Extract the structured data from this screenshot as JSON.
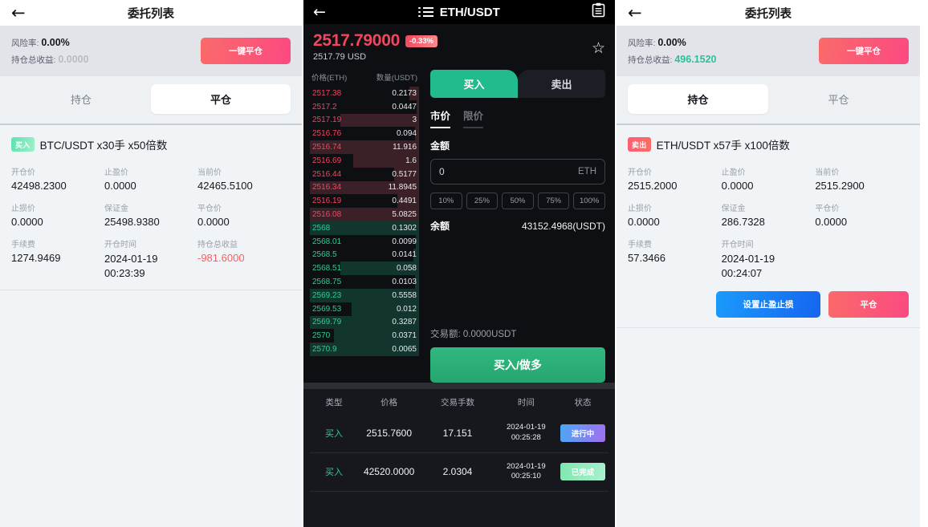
{
  "panel_left": {
    "header": {
      "back_icon": "back-arrow-icon",
      "title": "委托列表"
    },
    "risk": {
      "risk_label": "风险率:",
      "risk_value": "0.00%",
      "profit_label": "持仓总收益:",
      "profit_value": "0.0000",
      "close_all_label": "一键平仓"
    },
    "tabs": [
      {
        "label": "持仓",
        "active": false
      },
      {
        "label": "平仓",
        "active": true
      }
    ],
    "card": {
      "side_tag": "买入",
      "side_type": "buy",
      "title": "BTC/USDT x30手 x50倍数",
      "fields": [
        {
          "label": "开仓价",
          "value": "42498.2300",
          "tone": "normal"
        },
        {
          "label": "止盈价",
          "value": "0.0000",
          "tone": "normal"
        },
        {
          "label": "当前价",
          "value": "42465.5100",
          "tone": "normal"
        },
        {
          "label": "止损价",
          "value": "0.0000",
          "tone": "normal"
        },
        {
          "label": "保证金",
          "value": "25498.9380",
          "tone": "normal"
        },
        {
          "label": "平仓价",
          "value": "0.0000",
          "tone": "normal"
        },
        {
          "label": "手续费",
          "value": "1274.9469",
          "tone": "normal"
        },
        {
          "label": "开仓时间",
          "value": "2024-01-19 00:23:39",
          "tone": "time"
        },
        {
          "label": "持仓总收益",
          "value": "-981.6000",
          "tone": "negative"
        }
      ]
    }
  },
  "panel_middle": {
    "header": {
      "back_icon": "back-arrow-icon",
      "list_icon": "list-icon",
      "title": "ETH/USDT",
      "clipboard_icon": "clipboard-icon"
    },
    "ticker": {
      "price": "2517.79000",
      "change_pct": "-0.33%",
      "usd": "2517.79 USD",
      "star_icon": "star-icon"
    },
    "orderbook": {
      "col_price": "价格(ETH)",
      "col_amount": "数量(USDT)",
      "asks": [
        {
          "price": "2517.38",
          "amount": "0.2173",
          "depth": 9
        },
        {
          "price": "2517.2",
          "amount": "0.0447",
          "depth": 2
        },
        {
          "price": "2517.19",
          "amount": "3",
          "depth": 72
        },
        {
          "price": "2516.76",
          "amount": "0.094",
          "depth": 4
        },
        {
          "price": "2516.74",
          "amount": "11.916",
          "depth": 100
        },
        {
          "price": "2516.69",
          "amount": "1.6",
          "depth": 60
        },
        {
          "price": "2516.44",
          "amount": "0.5177",
          "depth": 23
        },
        {
          "price": "2516.34",
          "amount": "11.8945",
          "depth": 100
        },
        {
          "price": "2516.19",
          "amount": "0.4491",
          "depth": 20
        },
        {
          "price": "2516.08",
          "amount": "5.0825",
          "depth": 100
        }
      ],
      "bids": [
        {
          "price": "2568",
          "amount": "0.1302",
          "depth": 100
        },
        {
          "price": "2568.01",
          "amount": "0.0099",
          "depth": 3
        },
        {
          "price": "2568.5",
          "amount": "0.0141",
          "depth": 5
        },
        {
          "price": "2568.51",
          "amount": "0.058",
          "depth": 72
        },
        {
          "price": "2568.75",
          "amount": "0.0103",
          "depth": 4
        },
        {
          "price": "2569.23",
          "amount": "0.5558",
          "depth": 100
        },
        {
          "price": "2569.53",
          "amount": "0.012",
          "depth": 62
        },
        {
          "price": "2569.79",
          "amount": "0.3287",
          "depth": 100
        },
        {
          "price": "2570",
          "amount": "0.0371",
          "depth": 78
        },
        {
          "price": "2570.9",
          "amount": "0.0065",
          "depth": 100
        }
      ]
    },
    "form": {
      "buy_tab": "买入",
      "sell_tab": "卖出",
      "market_tab": "市价",
      "limit_tab": "限价",
      "amount_label": "金额",
      "amount_value": "0",
      "amount_unit": "ETH",
      "percents": [
        "10%",
        "25%",
        "50%",
        "75%",
        "100%"
      ],
      "balance_label": "余额",
      "balance_value": "43152.4968(USDT)",
      "turnover_label": "交易额:",
      "turnover_value": "0.0000USDT",
      "submit_label": "买入/做多"
    },
    "history": {
      "columns": [
        "类型",
        "价格",
        "交易手数",
        "时间",
        "状态"
      ],
      "rows": [
        {
          "type": "买入",
          "price": "2515.7600",
          "lots": "17.151",
          "date": "2024-01-19",
          "time": "00:25:28",
          "status": "进行中",
          "status_kind": "progress"
        },
        {
          "type": "买入",
          "price": "42520.0000",
          "lots": "2.0304",
          "date": "2024-01-19",
          "time": "00:25:10",
          "status": "已完成",
          "status_kind": "done"
        }
      ]
    }
  },
  "panel_right": {
    "header": {
      "back_icon": "back-arrow-icon",
      "title": "委托列表"
    },
    "risk": {
      "risk_label": "风险率:",
      "risk_value": "0.00%",
      "profit_label": "持仓总收益:",
      "profit_value": "496.1520",
      "close_all_label": "一键平仓"
    },
    "tabs": [
      {
        "label": "持仓",
        "active": true
      },
      {
        "label": "平仓",
        "active": false
      }
    ],
    "card": {
      "side_tag": "卖出",
      "side_type": "sell",
      "title": "ETH/USDT x57手 x100倍数",
      "fields": [
        {
          "label": "开仓价",
          "value": "2515.2000",
          "tone": "normal"
        },
        {
          "label": "止盈价",
          "value": "0.0000",
          "tone": "normal"
        },
        {
          "label": "当前价",
          "value": "2515.2900",
          "tone": "normal"
        },
        {
          "label": "止损价",
          "value": "0.0000",
          "tone": "normal"
        },
        {
          "label": "保证金",
          "value": "286.7328",
          "tone": "normal"
        },
        {
          "label": "平仓价",
          "value": "0.0000",
          "tone": "normal"
        },
        {
          "label": "手续费",
          "value": "57.3466",
          "tone": "normal"
        },
        {
          "label": "开仓时间",
          "value": "2024-01-19 00:24:07",
          "tone": "time"
        },
        {
          "label": "",
          "value": "",
          "tone": "empty"
        }
      ],
      "set_tp_sl_label": "设置止盈止损",
      "close_label": "平仓"
    }
  },
  "colors": {
    "up": "#2ecc9a",
    "down": "#f0475e",
    "accent_pink": "#fb4a82",
    "accent_blue": "#1565f0",
    "dark_bg": "#0d0f12"
  }
}
